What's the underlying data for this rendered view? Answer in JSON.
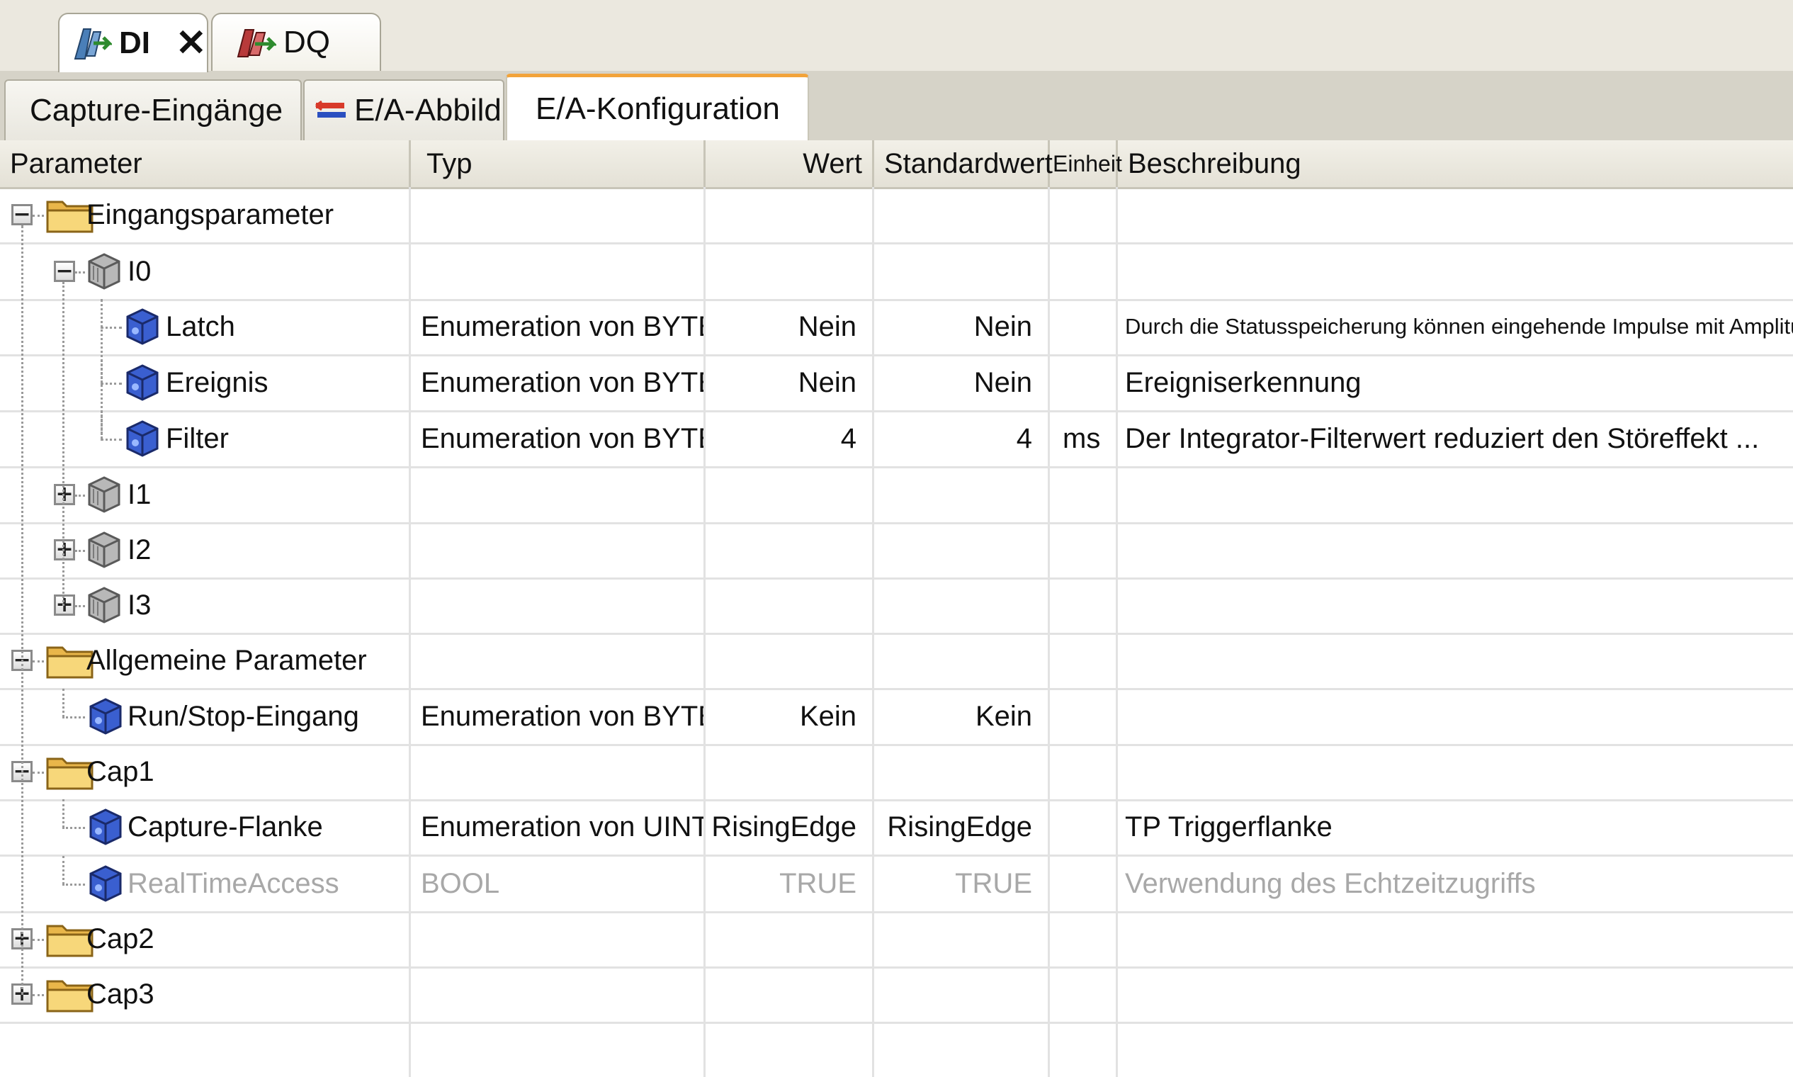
{
  "doc_tabs": [
    {
      "label": "DI",
      "active": true,
      "icon": "digital-input-icon",
      "close": "✕"
    },
    {
      "label": "DQ",
      "active": false,
      "icon": "digital-output-icon"
    }
  ],
  "sub_tabs": [
    {
      "label": "Capture-Eingänge",
      "active": false
    },
    {
      "label": "E/A-Abbild",
      "active": false,
      "icon": "io-image-icon"
    },
    {
      "label": "E/A-Konfiguration",
      "active": true
    }
  ],
  "columns": {
    "parameter": "Parameter",
    "typ": "Typ",
    "wert": "Wert",
    "standardwert": "Standardwert",
    "einheit": "Einheit",
    "beschreibung": "Beschreibung"
  },
  "rows": [
    {
      "name": "Eingangsparameter",
      "level": 0,
      "kind": "folder",
      "expander": "minus",
      "typ": "",
      "wert": "",
      "standardwert": "",
      "einheit": "",
      "beschreibung": ""
    },
    {
      "name": "I0",
      "level": 1,
      "kind": "module",
      "expander": "minus",
      "typ": "",
      "wert": "",
      "standardwert": "",
      "einheit": "",
      "beschreibung": ""
    },
    {
      "name": "Latch",
      "level": 2,
      "kind": "param",
      "typ": "Enumeration von BYTE",
      "wert": "Nein",
      "standardwert": "Nein",
      "einheit": "",
      "beschreibung": "Durch die Statusspeicherung können eingehende Impulse mit Amplitudenweiten, ..."
    },
    {
      "name": "Ereignis",
      "level": 2,
      "kind": "param",
      "typ": "Enumeration von BYTE",
      "wert": "Nein",
      "standardwert": "Nein",
      "einheit": "",
      "beschreibung": "Ereigniserkennung"
    },
    {
      "name": "Filter",
      "level": 2,
      "kind": "param",
      "typ": "Enumeration von BYTE",
      "wert": "4",
      "standardwert": "4",
      "einheit": "ms",
      "beschreibung": "Der Integrator-Filterwert reduziert den Störeffekt ..."
    },
    {
      "name": "I1",
      "level": 1,
      "kind": "module",
      "expander": "plus",
      "typ": "",
      "wert": "",
      "standardwert": "",
      "einheit": "",
      "beschreibung": ""
    },
    {
      "name": "I2",
      "level": 1,
      "kind": "module",
      "expander": "plus",
      "typ": "",
      "wert": "",
      "standardwert": "",
      "einheit": "",
      "beschreibung": ""
    },
    {
      "name": "I3",
      "level": 1,
      "kind": "module",
      "expander": "plus",
      "typ": "",
      "wert": "",
      "standardwert": "",
      "einheit": "",
      "beschreibung": ""
    },
    {
      "name": "Allgemeine Parameter",
      "level": 0,
      "kind": "folder",
      "expander": "minus",
      "typ": "",
      "wert": "",
      "standardwert": "",
      "einheit": "",
      "beschreibung": ""
    },
    {
      "name": "Run/Stop-Eingang",
      "level": 1,
      "kind": "param",
      "typ": "Enumeration von BYTE",
      "wert": "Kein",
      "standardwert": "Kein",
      "einheit": "",
      "beschreibung": ""
    },
    {
      "name": "Cap1",
      "level": 0,
      "kind": "folder",
      "expander": "minus",
      "typ": "",
      "wert": "",
      "standardwert": "",
      "einheit": "",
      "beschreibung": ""
    },
    {
      "name": "Capture-Flanke",
      "level": 1,
      "kind": "param",
      "typ": "Enumeration von UINT",
      "wert": "RisingEdge",
      "standardwert": "RisingEdge",
      "einheit": "",
      "beschreibung": "TP Triggerflanke"
    },
    {
      "name": "RealTimeAccess",
      "level": 1,
      "kind": "param",
      "disabled": true,
      "typ": "BOOL",
      "wert": "TRUE",
      "standardwert": "TRUE",
      "einheit": "",
      "beschreibung": "Verwendung des Echtzeitzugriffs"
    },
    {
      "name": "Cap2",
      "level": 0,
      "kind": "folder",
      "expander": "plus",
      "typ": "",
      "wert": "",
      "standardwert": "",
      "einheit": "",
      "beschreibung": ""
    },
    {
      "name": "Cap3",
      "level": 0,
      "kind": "folder",
      "expander": "plus",
      "typ": "",
      "wert": "",
      "standardwert": "",
      "einheit": "",
      "beschreibung": ""
    }
  ],
  "colors": {
    "accent": "#f2a33a",
    "grid_line": "#e2e2e2",
    "header_bg": "#e9e7de",
    "disabled_text": "#a8a8a8"
  }
}
